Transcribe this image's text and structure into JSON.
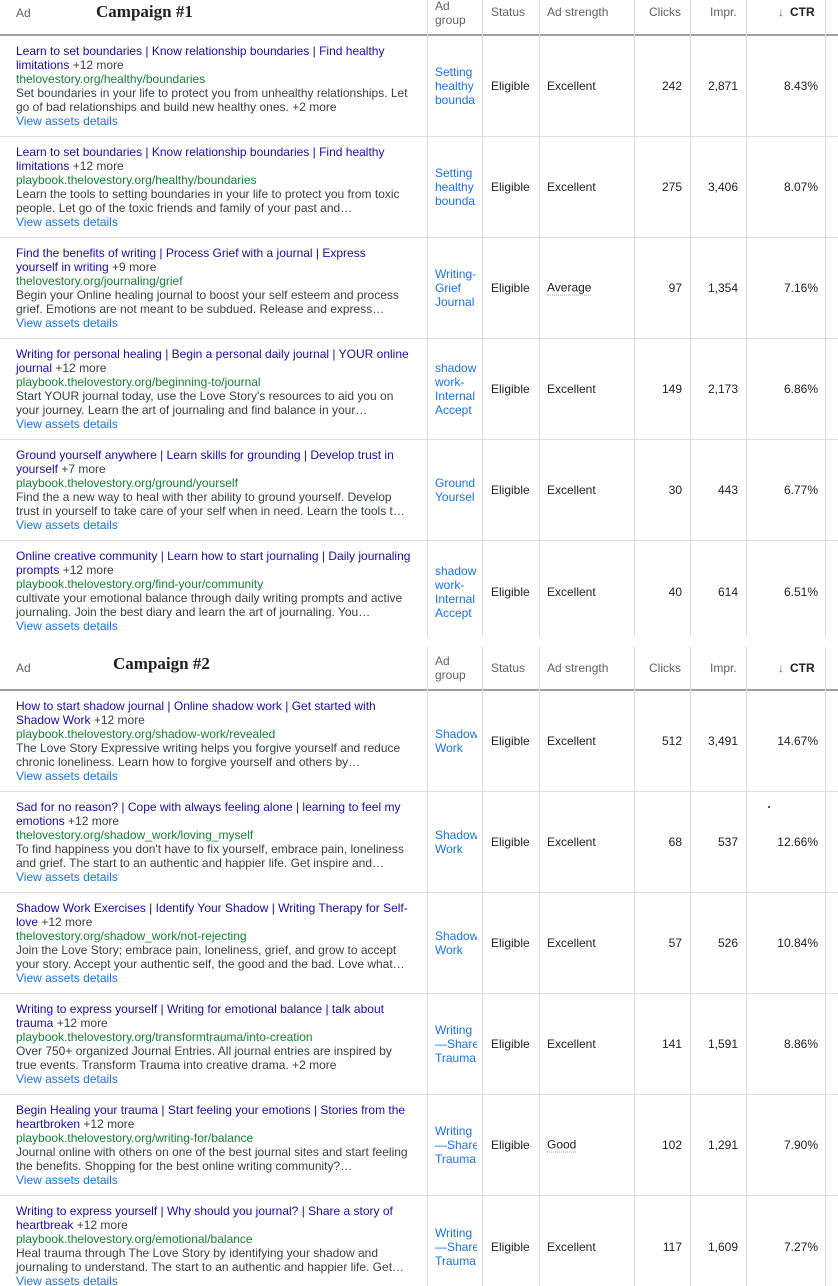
{
  "headers": {
    "ad": "Ad",
    "ad_group": [
      "Ad",
      "group"
    ],
    "status": "Status",
    "ad_strength": "Ad strength",
    "clicks": "Clicks",
    "impr": "Impr.",
    "ctr": "CTR",
    "sort_icon": "arrow-down-icon"
  },
  "campaigns": [
    {
      "title": "Campaign #1",
      "rows": [
        {
          "headline": "Learn to set boundaries | Know relationship boundaries | Find healthy limitations",
          "more": "+12 more",
          "url": "thelovestory.org/healthy/boundaries",
          "desc": "Set boundaries in your life to protect you from unhealthy relationships. Let go of bad relationships and build new healthy ones.",
          "desc_more": "+2 more",
          "view": "View assets details",
          "group": [
            "Setting",
            "healthy",
            "bounda"
          ],
          "status": "Eligible",
          "strength": "Excellent",
          "clicks": "242",
          "impr": "2,871",
          "ctr": "8.43%"
        },
        {
          "headline": "Learn to set boundaries | Know relationship boundaries | Find healthy limitations",
          "more": "+12 more",
          "url": "playbook.thelovestory.org/healthy/boundaries",
          "desc": "Learn the tools to setting boundaries in your life to protect you from toxic people. Let go of the toxic friends and family of your past and…",
          "desc_more": "",
          "view": "View assets details",
          "group": [
            "Setting",
            "healthy",
            "bounda"
          ],
          "status": "Eligible",
          "strength": "Excellent",
          "clicks": "275",
          "impr": "3,406",
          "ctr": "8.07%"
        },
        {
          "headline": "Find the benefits of writing | Process Grief with a journal | Express yourself in writing",
          "more": "+9 more",
          "url": "thelovestory.org/journaling/grief",
          "desc": "Begin your Online healing journal to boost your self esteem and process grief. Emotions are not meant to be subdued. Release and express…",
          "desc_more": "",
          "view": "View assets details",
          "group": [
            "Writing-",
            "Grief",
            "Journal"
          ],
          "status": "Eligible",
          "strength": "Average",
          "clicks": "97",
          "impr": "1,354",
          "ctr": "7.16%"
        },
        {
          "headline": "Writing for personal healing | Begin a personal daily journal | YOUR online journal",
          "more": "+12 more",
          "url": "playbook.thelovestory.org/beginning-to/journal",
          "desc": "Start YOUR journal today, use the Love Story's resources to aid you on your journey. Learn the art of journaling and find balance in your…",
          "desc_more": "",
          "view": "View assets details",
          "group": [
            "shadow",
            "work-",
            "Internal",
            "Accept"
          ],
          "status": "Eligible",
          "strength": "Excellent",
          "clicks": "149",
          "impr": "2,173",
          "ctr": "6.86%"
        },
        {
          "headline": "Ground yourself anywhere | Learn skills for grounding | Develop trust in yourself",
          "more": "+7 more",
          "url": "playbook.thelovestory.org/ground/yourself",
          "desc": "Find the a new way to heal with ther ability to ground yourself. Develop trust in yourself to take care of your self when in need. Learn the tools t…",
          "desc_more": "",
          "view": "View assets details",
          "group": [
            "Ground",
            "Yoursel"
          ],
          "status": "Eligible",
          "strength": "Excellent",
          "clicks": "30",
          "impr": "443",
          "ctr": "6.77%"
        },
        {
          "headline": "Online creative community | Learn how to start journaling | Daily journaling prompts",
          "more": "+12 more",
          "url": "playbook.thelovestory.org/find-your/community",
          "desc": "cultivate your emotional balance through daily writing prompts and active journaling. Join the best diary and learn the art of journaling. You…",
          "desc_more": "",
          "view": "View assets details",
          "group": [
            "shadow",
            "work-",
            "Internal",
            "Accept"
          ],
          "status": "Eligible",
          "strength": "Excellent",
          "clicks": "40",
          "impr": "614",
          "ctr": "6.51%"
        }
      ]
    },
    {
      "title": "Campaign #2",
      "rows": [
        {
          "headline": "How to start shadow journal | Online shadow work | Get started with Shadow Work",
          "more": "+12 more",
          "url": "playbook.thelovestory.org/shadow-work/revealed",
          "desc": "The Love Story Expressive writing helps you forgive yourself and reduce chronic loneliness. Learn how to forgive yourself and others by…",
          "desc_more": "",
          "view": "View assets details",
          "group": [
            "Shadow",
            "Work"
          ],
          "status": "Eligible",
          "strength": "Excellent",
          "clicks": "512",
          "impr": "3,491",
          "ctr": "14.67%"
        },
        {
          "headline": "Sad for no reason? | Cope with always feeling alone | learning to feel my emotions",
          "more": "+12 more",
          "url": "thelovestory.org/shadow_work/loving_myself",
          "desc": "To find happiness you don't have to fix yourself, embrace pain, loneliness and grief. The start to an authentic and happier life. Get inspire and…",
          "desc_more": "",
          "view": "View assets details",
          "group": [
            "Shadow",
            "Work"
          ],
          "status": "Eligible",
          "strength": "Excellent",
          "clicks": "68",
          "impr": "537",
          "ctr": "12.66%"
        },
        {
          "headline": "Shadow Work Exercises | Identify Your Shadow | Writing Therapy for Self-love",
          "more": "+12 more",
          "url": "thelovestory.org/shadow_work/not-rejecting",
          "desc": "Join the Love Story; embrace pain, loneliness, grief, and grow to accept your story. Accept your authentic self, the good and the bad. Love what…",
          "desc_more": "",
          "view": "View assets details",
          "group": [
            "Shadow",
            "Work"
          ],
          "status": "Eligible",
          "strength": "Excellent",
          "clicks": "57",
          "impr": "526",
          "ctr": "10.84%"
        },
        {
          "headline": "Writing to express yourself | Writing for emotional balance | talk about trauma",
          "more": "+12 more",
          "url": "playbook.thelovestory.org/transformtrauma/into-creation",
          "desc": "Over 750+ organized Journal Entries. All journal entries are inspired by true events. Transform Trauma into creative drama.",
          "desc_more": "+2 more",
          "view": "View assets details",
          "group": [
            "Writing",
            "—Share",
            "Trauma"
          ],
          "status": "Eligible",
          "strength": "Excellent",
          "clicks": "141",
          "impr": "1,591",
          "ctr": "8.86%"
        },
        {
          "headline": "Begin Healing your trauma | Start feeling your emotions | Stories from the heartbroken",
          "more": "+12 more",
          "url": "playbook.thelovestory.org/writing-for/balance",
          "desc": "Journal online with others on one of the best journal sites and start feeling the benefits. Shopping for the best online writing community?…",
          "desc_more": "",
          "view": "View assets details",
          "group": [
            "Writing",
            "—Share",
            "Trauma"
          ],
          "status": "Eligible",
          "strength": "Good",
          "clicks": "102",
          "impr": "1,291",
          "ctr": "7.90%"
        },
        {
          "headline": "Writing to express yourself | Why should you journal? | Share a story of heartbreak",
          "more": "+12 more",
          "url": "playbook.thelovestory.org/emotional/balance",
          "desc": "Heal trauma through The Love Story by identifying your shadow and journaling to understand. The start to an authentic and happier life. Get…",
          "desc_more": "",
          "view": "View assets details",
          "group": [
            "Writing",
            "—Share",
            "Trauma"
          ],
          "status": "Eligible",
          "strength": "Excellent",
          "clicks": "117",
          "impr": "1,609",
          "ctr": "7.27%"
        }
      ]
    }
  ]
}
